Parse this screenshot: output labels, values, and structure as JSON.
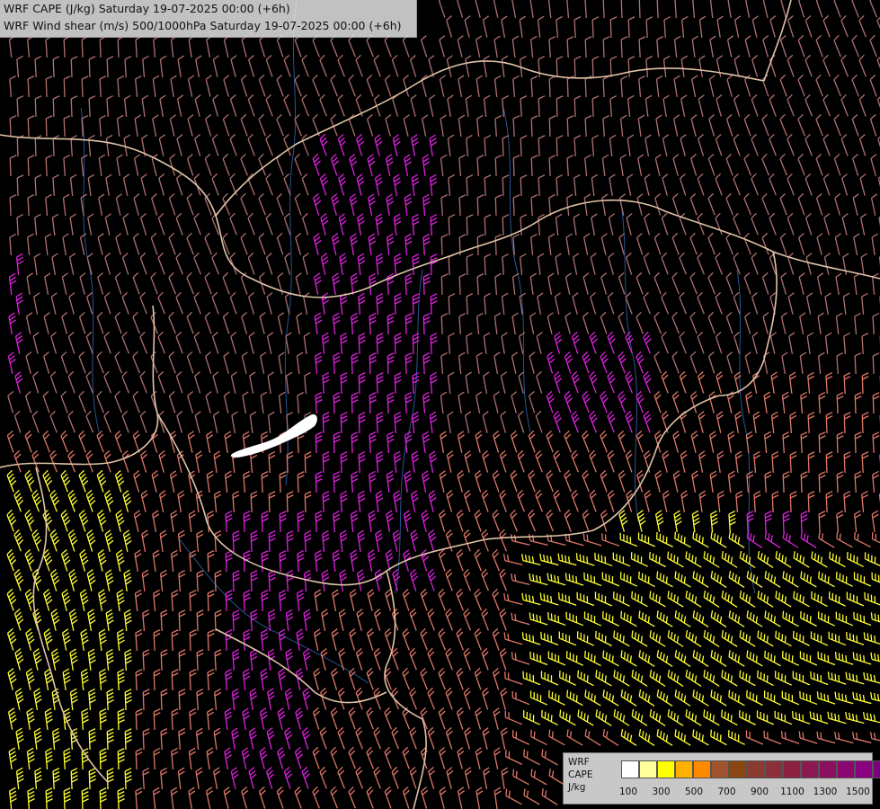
{
  "header": {
    "line1": "WRF CAPE (J/kg) Saturday 19-07-2025 00:00 (+6h)",
    "line2": "WRF Wind shear (m/s) 500/1000hPa Saturday 19-07-2025 00:00 (+6h)"
  },
  "legend": {
    "title_model": "WRF",
    "title_var": "CAPE",
    "title_unit": "J/kg",
    "colors": [
      "#ffffff",
      "#ffff9c",
      "#ffff00",
      "#ffb000",
      "#ff8a00",
      "#a0522d",
      "#8b4513",
      "#8b3a2f",
      "#8b2f3a",
      "#8b2040",
      "#8b1a50",
      "#8b1060",
      "#8b0870",
      "#8b0080",
      "#7a0080"
    ],
    "ticks": [
      "100",
      "300",
      "500",
      "700",
      "900",
      "1100",
      "1300",
      "1500"
    ]
  },
  "map": {
    "background_color": "#000000",
    "border_color": "#e0c4a8",
    "river_color": "#2a5fa0",
    "barb_colors": {
      "weak": "#b07070",
      "moderate": "#e07868",
      "strong": "#e020e0",
      "very_strong": "#ffff33"
    },
    "cape_patch_color": "#ffffff"
  }
}
